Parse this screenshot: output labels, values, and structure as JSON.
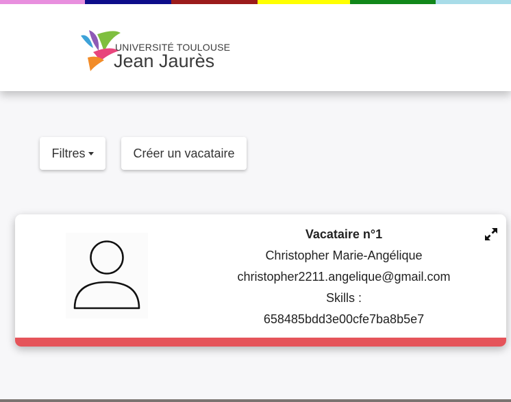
{
  "header": {
    "color_strip": [
      "#e88fde",
      "#0d0d8a",
      "#9b1b1b",
      "#ffff00",
      "#11871a",
      "#a8dce8"
    ],
    "logo": {
      "line1": "UNIVERSITÉ TOULOUSE",
      "line2": "Jean Jaurès",
      "colors": [
        "#3da2d8",
        "#8e5ab6",
        "#e8457c",
        "#f28c28",
        "#7fbf3f"
      ]
    }
  },
  "toolbar": {
    "filters_label": "Filtres",
    "create_label": "Créer un vacataire"
  },
  "card": {
    "title": "Vacataire n°1",
    "name": "Christopher Marie-Angélique",
    "email": "christopher2211.angelique@gmail.com",
    "skills": "Skills :",
    "id": "658485bdd3e00cfe7ba8b5e7",
    "accent_color": "#e5545a",
    "avatar_icon": "user-avatar-icon",
    "expand_icon": "expand-icon"
  }
}
